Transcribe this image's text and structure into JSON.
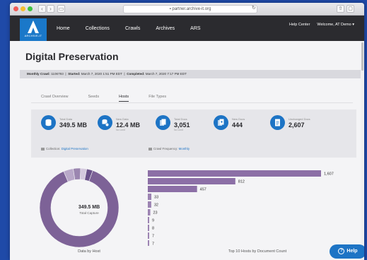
{
  "browser": {
    "url": "partner.archive-it.org",
    "nav_back": "‹",
    "nav_forward": "›",
    "sidebar_btn": "▭",
    "reload": "↻",
    "share_icon": "share-icon",
    "tabs_icon": "tabs-icon"
  },
  "header": {
    "logo_text": "ARCHIVE-IT",
    "nav": [
      "Home",
      "Collections",
      "Crawls",
      "Archives",
      "ARS"
    ],
    "help_center": "Help Center",
    "welcome": "Welcome, AT Demo",
    "welcome_caret": "▾"
  },
  "page": {
    "title": "Digital Preservation",
    "crawl_info": {
      "monthly_label": "Monthly Crawl:",
      "monthly_value": "1106793",
      "started_label": "Started:",
      "started_value": "March 7, 2020 1:51 PM EDT",
      "completed_label": "Completed:",
      "completed_value": "March 7, 2020 7:17 PM EDT",
      "sep": "|"
    },
    "tabs": [
      "Crawl Overview",
      "Seeds",
      "Hosts",
      "File Types"
    ],
    "active_tab": "Hosts"
  },
  "stats": [
    {
      "label": "Total Data",
      "value": "349.5 MB",
      "sub": "",
      "icon": "database-icon"
    },
    {
      "label": "New Data",
      "value": "12.4 MB",
      "sub": "No Limit",
      "icon": "database-plus-icon"
    },
    {
      "label": "Total Docs",
      "value": "3,051",
      "sub": "No Limit",
      "icon": "documents-icon"
    },
    {
      "label": "New Docs",
      "value": "444",
      "sub": "",
      "icon": "new-documents-icon"
    },
    {
      "label": "Unchanged Docs",
      "value": "2,607",
      "sub": "",
      "icon": "unchanged-document-icon"
    }
  ],
  "meta": {
    "collection_label": "Collection:",
    "collection_value": "Digital Preservation",
    "frequency_label": "Crawl Frequency:",
    "frequency_value": "Monthly"
  },
  "charts": {
    "donut_value": "349.5 MB",
    "donut_label": "Total Capture",
    "donut_caption": "Data by Host",
    "bar_caption": "Top 10 Hosts by Document Count"
  },
  "colors": {
    "accent": "#1d74c5",
    "bar": "#8c6fa6",
    "donut_main": "#7d6297"
  },
  "help_button": "Help",
  "chart_data": [
    {
      "type": "pie",
      "title": "Data by Host",
      "center_value": "349.5 MB",
      "center_label": "Total Capture",
      "values": [
        88,
        4,
        3,
        2.5,
        2.5
      ],
      "colors": [
        "#7d6297",
        "#b9a8c9",
        "#9b86b0",
        "#d4c9de",
        "#6a528a"
      ]
    },
    {
      "type": "bar",
      "title": "Top 10 Hosts by Document Count",
      "orientation": "horizontal",
      "values": [
        1607,
        812,
        457,
        33,
        32,
        23,
        9,
        8,
        7,
        7
      ]
    }
  ]
}
